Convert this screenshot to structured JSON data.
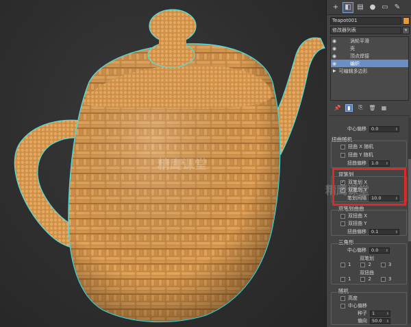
{
  "toolbar": {
    "icons": [
      "plus-icon",
      "modify-icon",
      "hierarchy-icon",
      "motion-icon",
      "display-icon",
      "utilities-icon"
    ]
  },
  "object": {
    "name": "Teapot001",
    "color": "#e49a3a"
  },
  "modifier_list": {
    "label": "修改器列表"
  },
  "stack": {
    "items": [
      "涡轮平滑",
      "壳",
      "顶点焊接",
      "编织"
    ],
    "selected_index": 3,
    "base": "可编辑多边形"
  },
  "params": {
    "center_offset_label": "中心偏移",
    "center_offset_value": "0.0",
    "twist_random": {
      "title": "扭曲随机",
      "x_label": "扭曲 X 随机",
      "y_label": "扭曲 Y 随机",
      "offset_label": "扭曲偏移",
      "offset_value": "1.0"
    },
    "double_stroke": {
      "title": "双笔划",
      "x_label": "双笔划 X",
      "y_label": "双笔划 Y",
      "gap_label": "笔划间隔",
      "gap_value": "10.0",
      "x_checked": true,
      "y_checked": true
    },
    "double_twist": {
      "title": "双笔划曲曲",
      "x_label": "双扭曲 X",
      "y_label": "双扭曲 Y",
      "offset_label": "扭曲偏移",
      "offset_value": "0.1"
    },
    "triangle": {
      "title": "三角形",
      "center_label": "中心偏移",
      "center_value": "0.0",
      "stroke_label": "双笔划",
      "stroke_opts": [
        "1",
        "2",
        "3"
      ],
      "twist_label": "双扭曲",
      "twist_opts": [
        "1",
        "2",
        "3"
      ]
    },
    "random": {
      "title": "随机",
      "height_label": "高度",
      "center_label": "中心偏移",
      "seed_label": "种子",
      "seed_value": "1",
      "bias_label": "偏向",
      "bias_value": "50.0"
    }
  },
  "watermark": "精鹰课堂"
}
